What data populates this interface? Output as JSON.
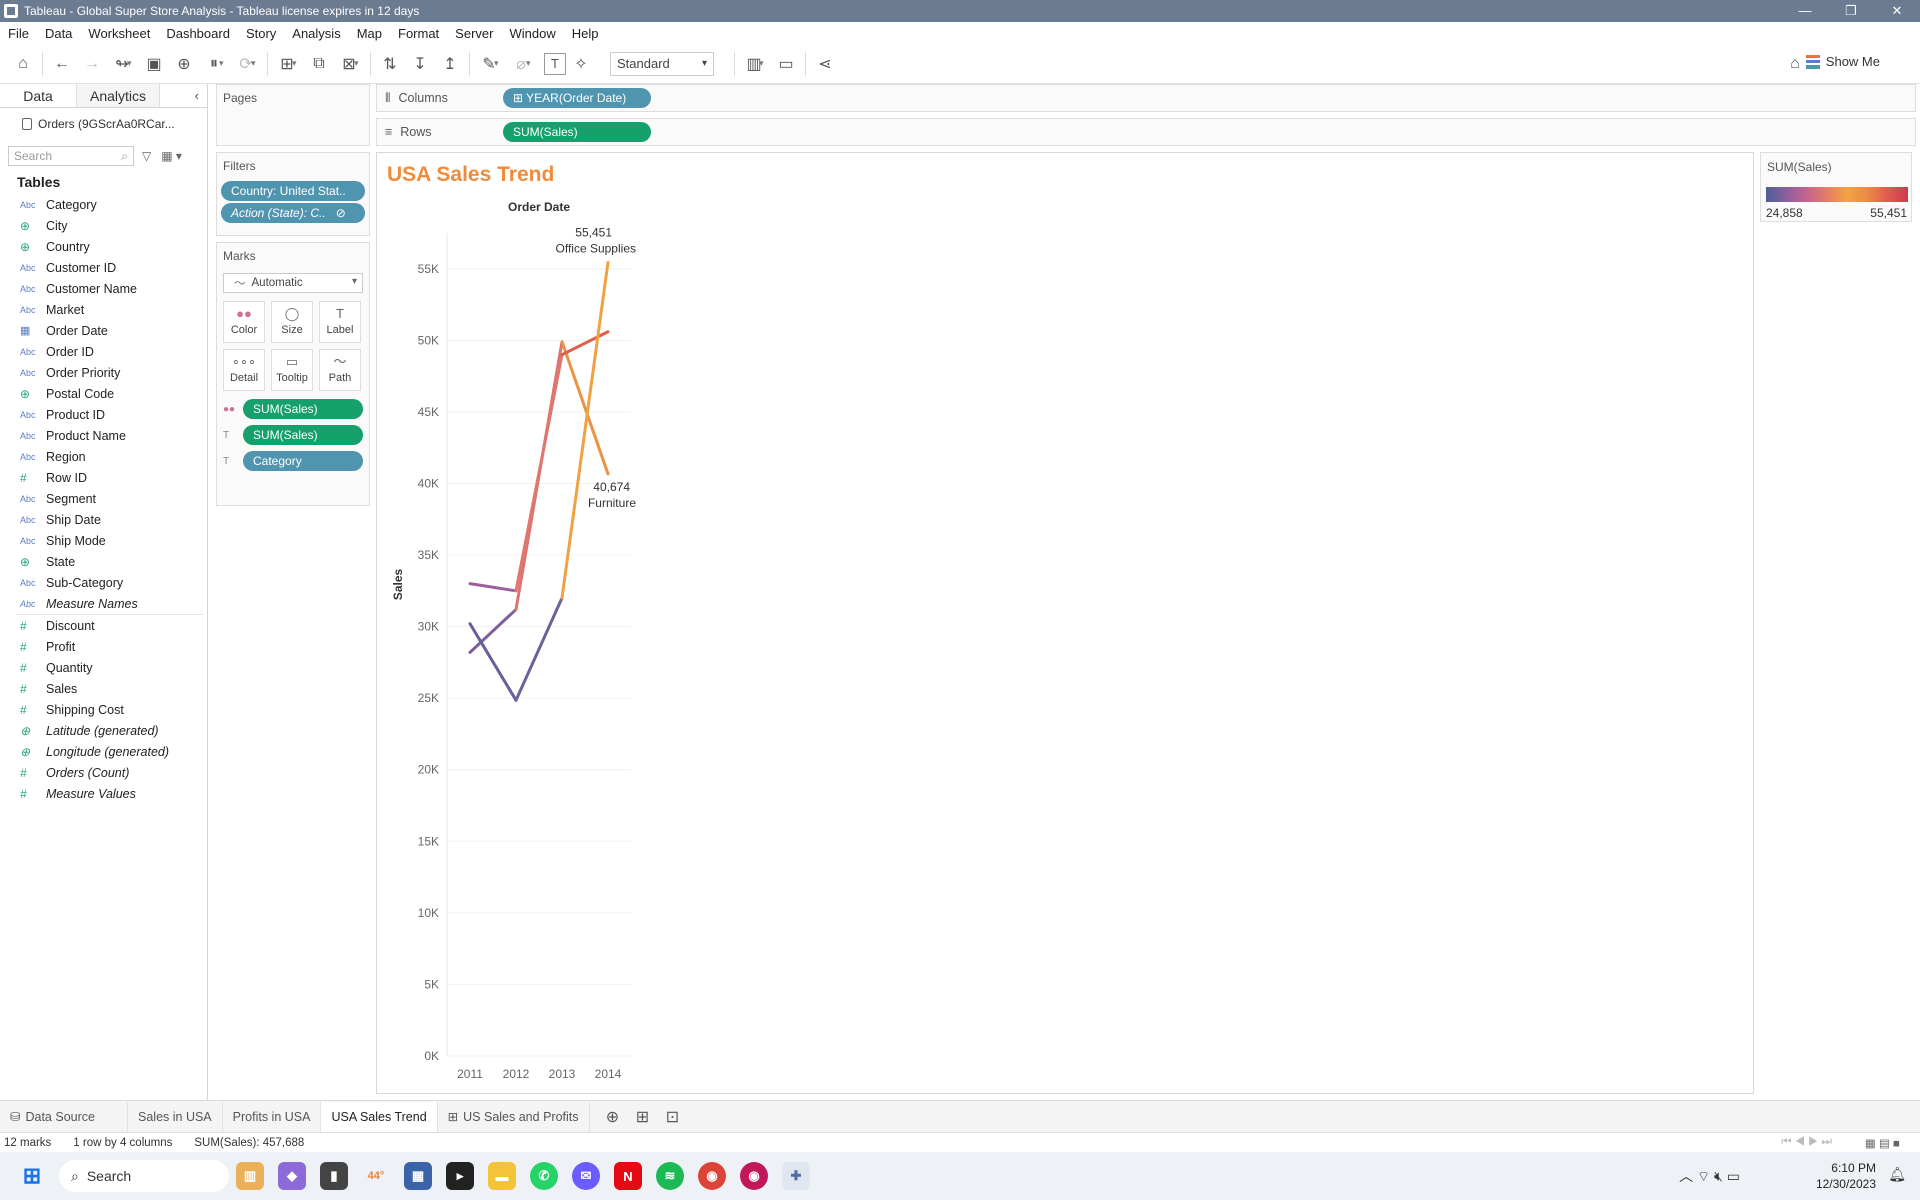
{
  "window": {
    "title": "Tableau - Global Super Store Analysis - Tableau license expires in 12 days"
  },
  "menu": [
    "File",
    "Data",
    "Worksheet",
    "Dashboard",
    "Story",
    "Analysis",
    "Map",
    "Format",
    "Server",
    "Window",
    "Help"
  ],
  "toolbar": {
    "fit_label": "Standard",
    "show_me_label": "Show Me"
  },
  "left_panel": {
    "tabs": [
      "Data",
      "Analytics"
    ],
    "datasource": "Orders (9GScrAa0RCar...",
    "search_placeholder": "Search",
    "tables_header": "Tables",
    "dimensions": [
      {
        "type": "Abc",
        "name": "Category"
      },
      {
        "type": "geo",
        "name": "City"
      },
      {
        "type": "geo",
        "name": "Country"
      },
      {
        "type": "Abc",
        "name": "Customer ID"
      },
      {
        "type": "Abc",
        "name": "Customer Name"
      },
      {
        "type": "Abc",
        "name": "Market"
      },
      {
        "type": "date",
        "name": "Order Date"
      },
      {
        "type": "Abc",
        "name": "Order ID"
      },
      {
        "type": "Abc",
        "name": "Order Priority"
      },
      {
        "type": "geo",
        "name": "Postal Code"
      },
      {
        "type": "Abc",
        "name": "Product ID"
      },
      {
        "type": "Abc",
        "name": "Product Name"
      },
      {
        "type": "Abc",
        "name": "Region"
      },
      {
        "type": "#",
        "name": "Row ID"
      },
      {
        "type": "Abc",
        "name": "Segment"
      },
      {
        "type": "Abc",
        "name": "Ship Date"
      },
      {
        "type": "Abc",
        "name": "Ship Mode"
      },
      {
        "type": "geo",
        "name": "State"
      },
      {
        "type": "Abc",
        "name": "Sub-Category"
      },
      {
        "type": "Abc",
        "name": "Measure Names",
        "italic": true
      }
    ],
    "measures": [
      {
        "type": "#",
        "name": "Discount"
      },
      {
        "type": "#",
        "name": "Profit"
      },
      {
        "type": "#",
        "name": "Quantity"
      },
      {
        "type": "#",
        "name": "Sales"
      },
      {
        "type": "#",
        "name": "Shipping Cost"
      },
      {
        "type": "geo",
        "name": "Latitude (generated)",
        "italic": true
      },
      {
        "type": "geo",
        "name": "Longitude (generated)",
        "italic": true
      },
      {
        "type": "#",
        "name": "Orders (Count)",
        "italic": true
      },
      {
        "type": "#",
        "name": "Measure Values",
        "italic": true
      }
    ]
  },
  "cards": {
    "pages_label": "Pages",
    "filters_label": "Filters",
    "filters": [
      "Country: United Stat..",
      "Action (State): C.."
    ],
    "marks_label": "Marks",
    "mark_type": "Automatic",
    "mark_buttons": [
      {
        "icon": "●●",
        "label": "Color"
      },
      {
        "icon": "◯",
        "label": "Size"
      },
      {
        "icon": "T",
        "label": "Label"
      },
      {
        "icon": "∘∘∘",
        "label": "Detail"
      },
      {
        "icon": "▭",
        "label": "Tooltip"
      },
      {
        "icon": "〜",
        "label": "Path"
      }
    ],
    "mark_pills": [
      {
        "icon": "●●",
        "label": "SUM(Sales)",
        "color": "green"
      },
      {
        "icon": "T",
        "label": "SUM(Sales)",
        "color": "green"
      },
      {
        "icon": "T",
        "label": "Category",
        "color": "blue"
      }
    ]
  },
  "shelves": {
    "columns_label": "Columns",
    "columns_pill": "⊞ YEAR(Order Date)",
    "rows_label": "Rows",
    "rows_pill": "SUM(Sales)"
  },
  "viz": {
    "title": "USA Sales Trend"
  },
  "legend": {
    "title": "SUM(Sales)",
    "min": "24,858",
    "max": "55,451"
  },
  "chart_data": {
    "type": "line",
    "title": "USA Sales Trend",
    "xlabel": "Order Date",
    "ylabel": "Sales",
    "categories": [
      "2011",
      "2012",
      "2013",
      "2014"
    ],
    "ylim": [
      0,
      57500
    ],
    "yticks": [
      0,
      5000,
      10000,
      15000,
      20000,
      25000,
      30000,
      35000,
      40000,
      45000,
      50000,
      55000
    ],
    "ytick_labels": [
      "0K",
      "5K",
      "10K",
      "15K",
      "20K",
      "25K",
      "30K",
      "35K",
      "40K",
      "45K",
      "50K",
      "55K"
    ],
    "series": [
      {
        "values": [
          28200,
          31200,
          49900,
          40674
        ]
      },
      {
        "values": [
          33000,
          32500,
          49000,
          50600
        ]
      },
      {
        "values": [
          30200,
          24858,
          32000,
          55451
        ]
      }
    ],
    "annotations": [
      {
        "value": "55,451",
        "label": "Office Supplies",
        "series": 2,
        "point": 3
      },
      {
        "value": "40,674",
        "label": "Furniture",
        "series": 0,
        "point": 3
      }
    ]
  },
  "sheet_tabs": [
    "Data Source",
    "Sales in USA",
    "Profits in USA",
    "USA Sales Trend",
    "US Sales and Profits"
  ],
  "status": {
    "marks": "12 marks",
    "dims": "1 row by 4 columns",
    "sum": "SUM(Sales): 457,688"
  },
  "taskbar": {
    "search": "Search",
    "weather": "44°",
    "time": "6:10 PM",
    "date": "12/30/2023"
  }
}
